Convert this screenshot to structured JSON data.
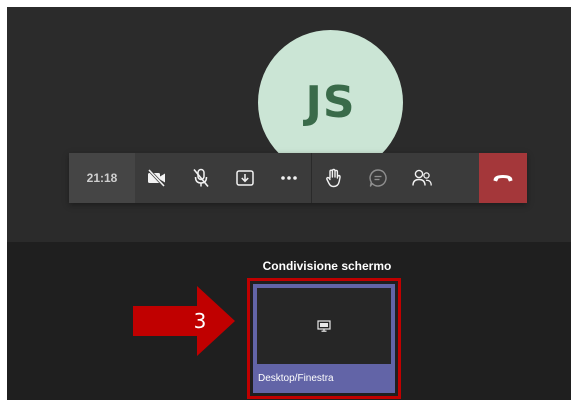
{
  "meeting": {
    "avatar_initials": "JS",
    "timer": "21:18"
  },
  "callbar": {
    "buttons": [
      {
        "name": "camera-off",
        "icon": "video-off-icon"
      },
      {
        "name": "mic-off",
        "icon": "mic-off-icon"
      },
      {
        "name": "share",
        "icon": "share-tray-icon"
      },
      {
        "name": "more",
        "icon": "more-icon"
      },
      {
        "name": "raise-hand",
        "icon": "hand-icon"
      },
      {
        "name": "chat",
        "icon": "chat-icon"
      },
      {
        "name": "participants",
        "icon": "people-icon"
      },
      {
        "name": "hang-up",
        "icon": "phone-hangup-icon"
      }
    ]
  },
  "share_panel": {
    "title": "Condivisione schermo",
    "tile_label": "Desktop/Finestra"
  },
  "annotation": {
    "step_number": "3"
  },
  "colors": {
    "meeting_bg": "#2b2b2b",
    "avatar_bg": "#cbe5d5",
    "avatar_text": "#3a6b4a",
    "hangup_red": "#a4373a",
    "tile_accent": "#6264a7",
    "highlight_red": "#c00000"
  }
}
